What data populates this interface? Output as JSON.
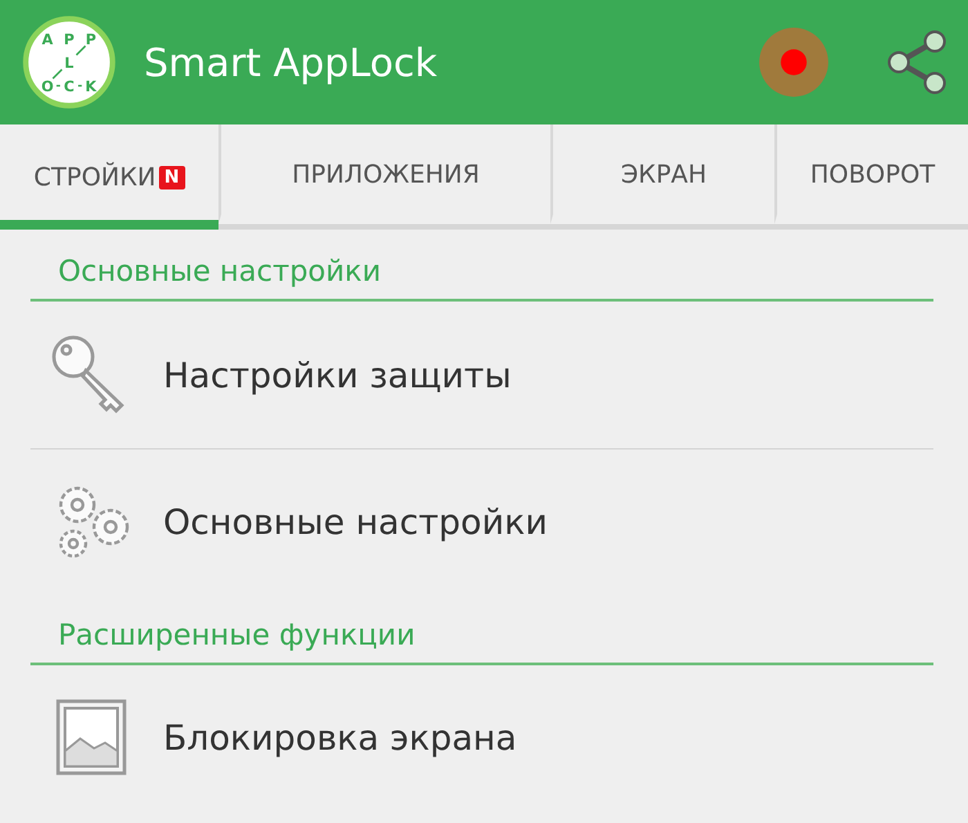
{
  "app_bar": {
    "title": "Smart AppLock",
    "logo_letters": [
      "A",
      "P",
      "P",
      "L",
      "O",
      "C",
      "K"
    ]
  },
  "tabs": [
    {
      "label": "СТРОЙКИ",
      "badge": "N",
      "selected": true
    },
    {
      "label": "ПРИЛОЖЕНИЯ",
      "selected": false
    },
    {
      "label": "ЭКРАН",
      "selected": false
    },
    {
      "label": "ПОВОРОТ",
      "selected": false
    }
  ],
  "sections": [
    {
      "title": "Основные настройки",
      "rows": [
        {
          "label": "Настройки защиты"
        },
        {
          "label": "Основные настройки"
        }
      ]
    },
    {
      "title": "Расширенные функции",
      "rows": [
        {
          "label": "Блокировка экрана"
        }
      ]
    }
  ]
}
